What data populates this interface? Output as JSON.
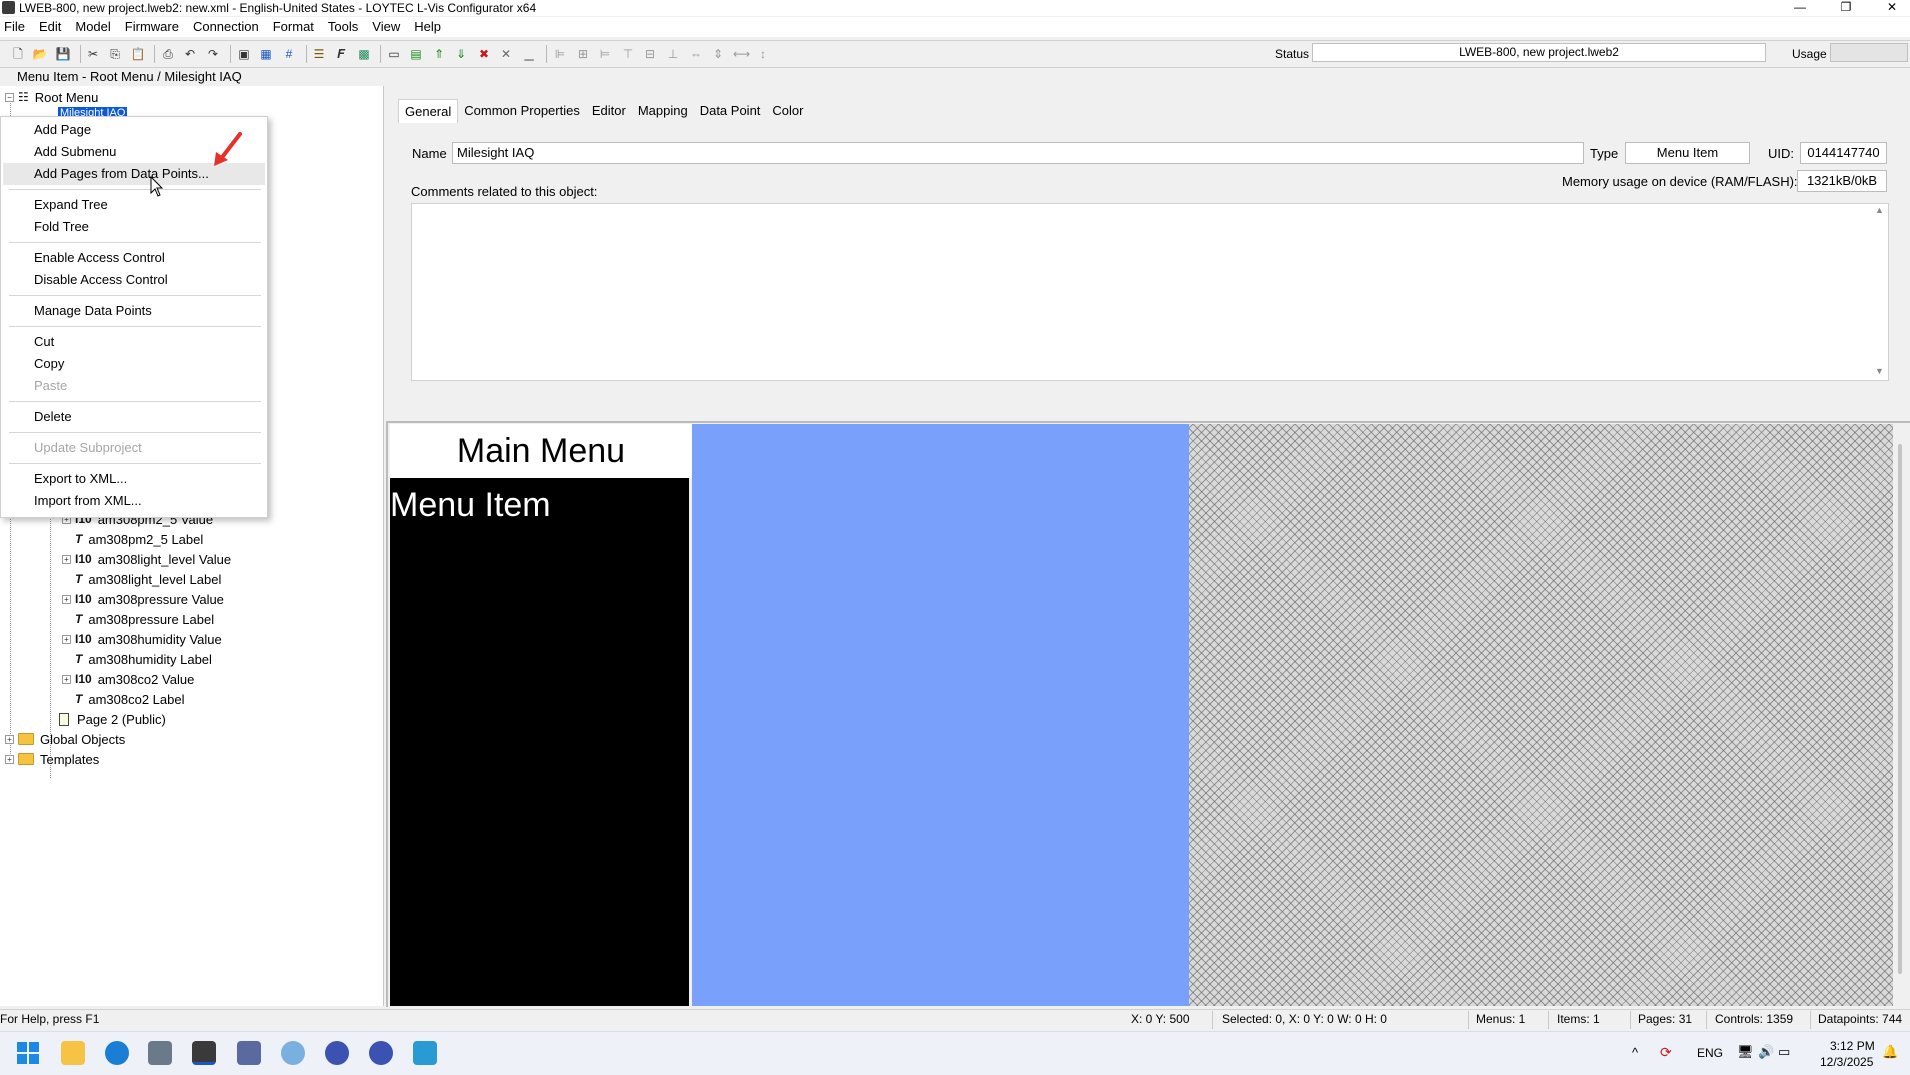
{
  "window": {
    "title": "LWEB-800, new project.lweb2: new.xml - English-United States - LOYTEC L-Vis Configurator x64",
    "controls": [
      "—",
      "❐",
      "✕"
    ]
  },
  "menubar": [
    "File",
    "Edit",
    "Model",
    "Firmware",
    "Connection",
    "Format",
    "Tools",
    "View",
    "Help"
  ],
  "toolbar": {
    "icons": [
      "new-icon",
      "open-icon",
      "save-icon",
      "cut-icon",
      "copy-icon",
      "paste-icon",
      "print-icon",
      "undo-icon",
      "redo-icon",
      "layers-icon",
      "grid-icon",
      "snap-icon",
      "font-icon",
      "text-icon",
      "image-icon",
      "align-icon",
      "group-icon",
      "ungroup-icon",
      "distribute-icon",
      "delete-icon",
      "close-icon"
    ],
    "status_label": "Status",
    "status_value": "LWEB-800, new project.lweb2",
    "usage_label": "Usage"
  },
  "breadcrumb": "Menu Item - Root Menu / Milesight IAQ",
  "tree": {
    "root": "Root Menu",
    "selected": "Milesight IAQ",
    "items": [
      {
        "label": "am308pm2_5 Value",
        "kind": "value"
      },
      {
        "label": "am308pm2_5 Label",
        "kind": "label"
      },
      {
        "label": "am308light_level Value",
        "kind": "value"
      },
      {
        "label": "am308light_level Label",
        "kind": "label"
      },
      {
        "label": "am308pressure Value",
        "kind": "value"
      },
      {
        "label": "am308pressure Label",
        "kind": "label"
      },
      {
        "label": "am308humidity Value",
        "kind": "value"
      },
      {
        "label": "am308humidity Label",
        "kind": "label"
      },
      {
        "label": "am308co2 Value",
        "kind": "value"
      },
      {
        "label": "am308co2 Label",
        "kind": "label"
      }
    ],
    "page2": "Page 2 (Public)",
    "global_objects": "Global Objects",
    "templates": "Templates",
    "value_glyph": "I10",
    "label_glyph": "T"
  },
  "context_menu": {
    "items": [
      {
        "label": "Add Page",
        "enabled": true
      },
      {
        "label": "Add Submenu",
        "enabled": true
      },
      {
        "label": "Add Pages from Data Points...",
        "enabled": true
      },
      {
        "label": "Expand Tree",
        "enabled": true
      },
      {
        "label": "Fold Tree",
        "enabled": true
      },
      {
        "label": "Enable Access Control",
        "enabled": true
      },
      {
        "label": "Disable Access Control",
        "enabled": true
      },
      {
        "label": "Manage Data Points",
        "enabled": true
      },
      {
        "label": "Cut",
        "enabled": true
      },
      {
        "label": "Copy",
        "enabled": true
      },
      {
        "label": "Paste",
        "enabled": false
      },
      {
        "label": "Delete",
        "enabled": true
      },
      {
        "label": "Update Subproject",
        "enabled": false
      },
      {
        "label": "Export to XML...",
        "enabled": true
      },
      {
        "label": "Import from XML...",
        "enabled": true
      }
    ],
    "highlighted": "Add Pages from Data Points..."
  },
  "tabs": [
    "General",
    "Common Properties",
    "Editor",
    "Mapping",
    "Data Point",
    "Color"
  ],
  "active_tab": "General",
  "general": {
    "name_label": "Name",
    "name_value": "Milesight IAQ",
    "type_label": "Type",
    "type_value": "Menu Item",
    "uid_label": "UID:",
    "uid_value": "0144147740",
    "memory_label": "Memory usage on device (RAM/FLASH):",
    "memory_value": "1321kB/0kB",
    "comments_label": "Comments related to this object:"
  },
  "canvas": {
    "header_text": "Main Menu",
    "menu_item_text": "Menu Item",
    "colors": {
      "blue": "#79a1fb",
      "black": "#000000",
      "white": "#ffffff"
    }
  },
  "statusbar": {
    "help": "For Help, press F1",
    "coords": "X: 0 Y: 500",
    "selected": "Selected: 0, X: 0 Y: 0 W: 0 H: 0",
    "menus": "Menus: 1",
    "items": "Items: 1",
    "pages": "Pages: 31",
    "controls": "Controls: 1359",
    "datapoints": "Datapoints: 744"
  },
  "taskbar": {
    "lang": "ENG",
    "time": "3:12 PM",
    "date": "12/3/2025"
  }
}
